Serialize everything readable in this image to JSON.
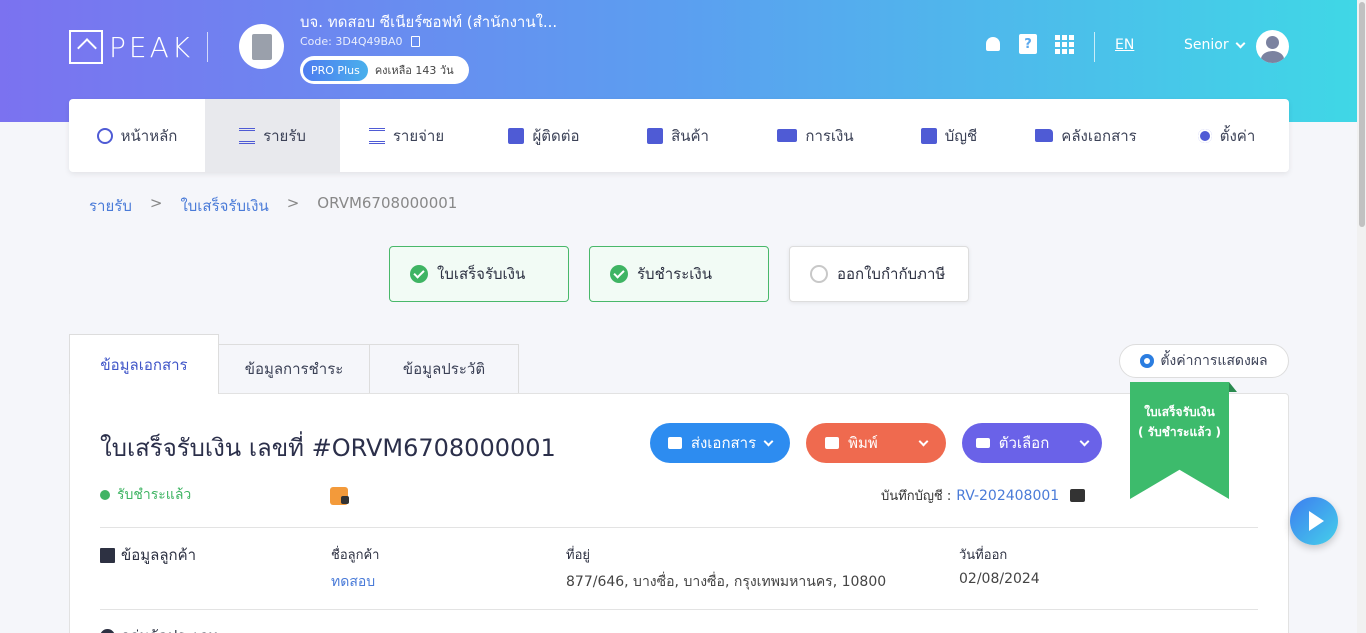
{
  "header": {
    "logo_text": "PEAK",
    "company_name": "บจ. ทดสอบ ซีเนียร์ซอฟท์ (สำนักงานใ...",
    "company_code": "Code: 3D4Q49BA0",
    "plan_badge": "PRO Plus",
    "plan_remaining": "คงเหลือ 143 วัน",
    "language": "EN",
    "user_name": "Senior"
  },
  "nav": {
    "items": [
      {
        "label": "หน้าหลัก",
        "icon": "dashboard-icon"
      },
      {
        "label": "รายรับ",
        "icon": "income-icon",
        "active": true
      },
      {
        "label": "รายจ่าย",
        "icon": "expense-icon"
      },
      {
        "label": "ผู้ติดต่อ",
        "icon": "contacts-icon"
      },
      {
        "label": "สินค้า",
        "icon": "box-icon"
      },
      {
        "label": "การเงิน",
        "icon": "money-icon"
      },
      {
        "label": "บัญชี",
        "icon": "ledger-icon"
      },
      {
        "label": "คลังเอกสาร",
        "icon": "folder-icon"
      },
      {
        "label": "ตั้งค่า",
        "icon": "gear-icon"
      }
    ]
  },
  "breadcrumb": {
    "level1": "รายรับ",
    "level2": "ใบเสร็จรับเงิน",
    "current": "ORVM6708000001",
    "separator": ">"
  },
  "steps": [
    {
      "label": "ใบเสร็จรับเงิน",
      "status": "done"
    },
    {
      "label": "รับชำระเงิน",
      "status": "done"
    },
    {
      "label": "ออกใบกำกับภาษี",
      "status": "todo"
    }
  ],
  "tabs": [
    {
      "label": "ข้อมูลเอกสาร",
      "active": true
    },
    {
      "label": "ข้อมูลการชำระ"
    },
    {
      "label": "ข้อมูลประวัติ"
    }
  ],
  "display_settings_label": "ตั้งค่าการแสดงผล",
  "document": {
    "title": "ใบเสร็จรับเงิน เลขที่ #ORVM6708000001",
    "status": "รับชำระแล้ว",
    "record_label": "บันทึกบัญชี :",
    "record_value": "RV-202408001",
    "ribbon_line1": "ใบเสร็จรับเงิน",
    "ribbon_line2": "( รับชำระแล้ว )"
  },
  "actions": {
    "send": "ส่งเอกสาร",
    "print": "พิมพ์",
    "options": "ตัวเลือก"
  },
  "customer": {
    "section_title": "ข้อมูลลูกค้า",
    "name_label": "ชื่อลูกค้า",
    "name_value": "ทดสอบ",
    "address_label": "ที่อยู่",
    "address_value": "877/646, บางซื่อ, บางซื่อ, กรุงเทพมหานคร, 10800",
    "date_label": "วันที่ออก",
    "date_value": "02/08/2024"
  },
  "next_section_title": "กลุ่มจัดประเภท",
  "colors": {
    "accent": "#4f5bd5",
    "success": "#3fb463",
    "send": "#2d8cf0",
    "print": "#ef6a4f",
    "options": "#6a62e8"
  }
}
